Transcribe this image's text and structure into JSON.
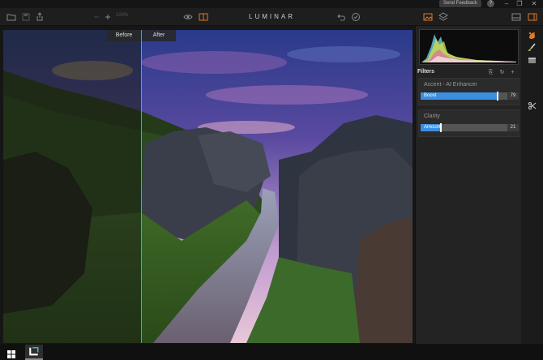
{
  "titlebar": {
    "feedback_label": "Send Feedback",
    "help_label": "?",
    "minimize": "–",
    "restore": "❐",
    "close": "✕"
  },
  "toolbar": {
    "zoom_label": "100%",
    "brand": "LUMINAR",
    "icons": [
      "open-folder-icon",
      "save-icon",
      "share-icon",
      "zoom-out-icon",
      "zoom-in-icon",
      "eye-icon",
      "compare-icon",
      "undo-icon",
      "history-icon",
      "image-icon",
      "layers-icon",
      "panel-bottom-icon",
      "panel-right-icon"
    ],
    "accent_color": "#e07a24"
  },
  "canvas": {
    "before_label": "Before",
    "after_label": "After",
    "split_fraction": 0.337
  },
  "panel": {
    "filters_title": "Filters",
    "filters": [
      {
        "name": "Accent - AI Enhancer",
        "slider_label": "Boost",
        "value": "79",
        "fraction": 0.79
      },
      {
        "name": "Clarity",
        "slider_label": "Amount",
        "value": "21",
        "fraction": 0.21
      }
    ],
    "slider_color": "#3b8fe0"
  },
  "strip": {
    "icons": [
      "presets-icon",
      "brush-icon",
      "panel-icon",
      "crop-icon"
    ]
  },
  "taskbar": {
    "icons": [
      "windows-start-icon",
      "luminar-app-icon"
    ]
  }
}
